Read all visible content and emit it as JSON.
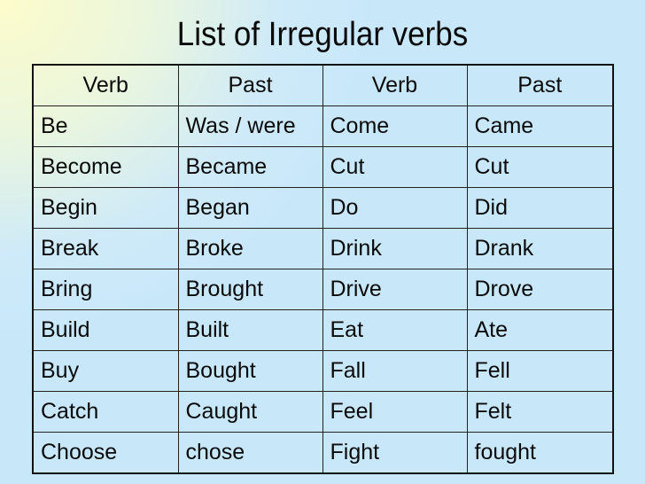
{
  "title": "List of Irregular verbs",
  "table": {
    "headers": [
      "Verb",
      "Past",
      "Verb",
      "Past"
    ],
    "rows": [
      [
        "Be",
        "Was / were",
        "Come",
        "Came"
      ],
      [
        "Become",
        "Became",
        "Cut",
        "Cut"
      ],
      [
        "Begin",
        "Began",
        "Do",
        "Did"
      ],
      [
        "Break",
        "Broke",
        "Drink",
        "Drank"
      ],
      [
        "Bring",
        "Brought",
        "Drive",
        "Drove"
      ],
      [
        "Build",
        "Built",
        "Eat",
        "Ate"
      ],
      [
        "Buy",
        "Bought",
        "Fall",
        "Fell"
      ],
      [
        "Catch",
        "Caught",
        "Feel",
        "Felt"
      ],
      [
        "Choose",
        "chose",
        "Fight",
        "fought"
      ]
    ]
  }
}
